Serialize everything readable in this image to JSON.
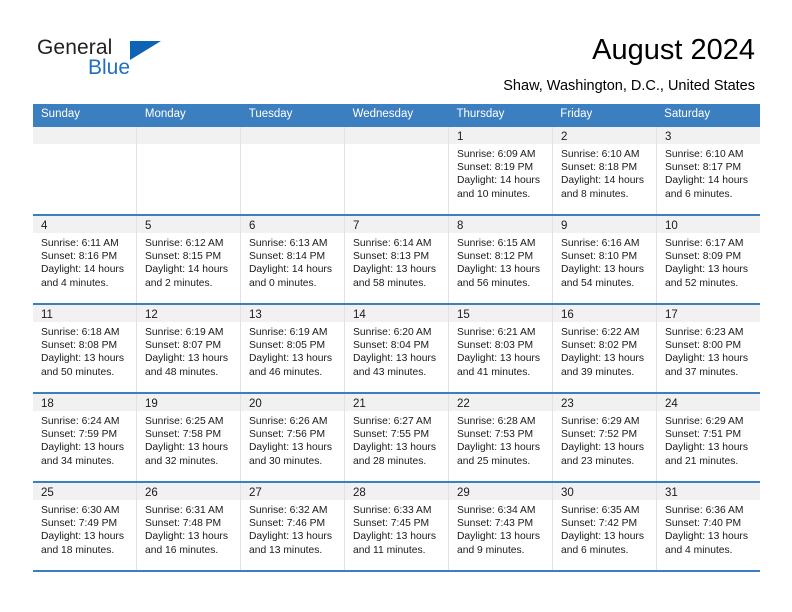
{
  "logo": {
    "word_top": "General",
    "word_bottom": "Blue",
    "accent_color": "#0f63b5"
  },
  "header": {
    "title": "August 2024",
    "subtitle": "Shaw, Washington, D.C., United States"
  },
  "calendar": {
    "header_color": "#3c7fc1",
    "weekdays": [
      "Sunday",
      "Monday",
      "Tuesday",
      "Wednesday",
      "Thursday",
      "Friday",
      "Saturday"
    ],
    "labels": {
      "sunrise": "Sunrise:",
      "sunset": "Sunset:",
      "daylight": "Daylight:"
    },
    "weeks": [
      [
        {
          "day": "",
          "sunrise": "",
          "sunset": "",
          "daylight_1": "",
          "daylight_2": ""
        },
        {
          "day": "",
          "sunrise": "",
          "sunset": "",
          "daylight_1": "",
          "daylight_2": ""
        },
        {
          "day": "",
          "sunrise": "",
          "sunset": "",
          "daylight_1": "",
          "daylight_2": ""
        },
        {
          "day": "",
          "sunrise": "",
          "sunset": "",
          "daylight_1": "",
          "daylight_2": ""
        },
        {
          "day": "1",
          "sunrise": "Sunrise: 6:09 AM",
          "sunset": "Sunset: 8:19 PM",
          "daylight_1": "Daylight: 14 hours",
          "daylight_2": "and 10 minutes."
        },
        {
          "day": "2",
          "sunrise": "Sunrise: 6:10 AM",
          "sunset": "Sunset: 8:18 PM",
          "daylight_1": "Daylight: 14 hours",
          "daylight_2": "and 8 minutes."
        },
        {
          "day": "3",
          "sunrise": "Sunrise: 6:10 AM",
          "sunset": "Sunset: 8:17 PM",
          "daylight_1": "Daylight: 14 hours",
          "daylight_2": "and 6 minutes."
        }
      ],
      [
        {
          "day": "4",
          "sunrise": "Sunrise: 6:11 AM",
          "sunset": "Sunset: 8:16 PM",
          "daylight_1": "Daylight: 14 hours",
          "daylight_2": "and 4 minutes."
        },
        {
          "day": "5",
          "sunrise": "Sunrise: 6:12 AM",
          "sunset": "Sunset: 8:15 PM",
          "daylight_1": "Daylight: 14 hours",
          "daylight_2": "and 2 minutes."
        },
        {
          "day": "6",
          "sunrise": "Sunrise: 6:13 AM",
          "sunset": "Sunset: 8:14 PM",
          "daylight_1": "Daylight: 14 hours",
          "daylight_2": "and 0 minutes."
        },
        {
          "day": "7",
          "sunrise": "Sunrise: 6:14 AM",
          "sunset": "Sunset: 8:13 PM",
          "daylight_1": "Daylight: 13 hours",
          "daylight_2": "and 58 minutes."
        },
        {
          "day": "8",
          "sunrise": "Sunrise: 6:15 AM",
          "sunset": "Sunset: 8:12 PM",
          "daylight_1": "Daylight: 13 hours",
          "daylight_2": "and 56 minutes."
        },
        {
          "day": "9",
          "sunrise": "Sunrise: 6:16 AM",
          "sunset": "Sunset: 8:10 PM",
          "daylight_1": "Daylight: 13 hours",
          "daylight_2": "and 54 minutes."
        },
        {
          "day": "10",
          "sunrise": "Sunrise: 6:17 AM",
          "sunset": "Sunset: 8:09 PM",
          "daylight_1": "Daylight: 13 hours",
          "daylight_2": "and 52 minutes."
        }
      ],
      [
        {
          "day": "11",
          "sunrise": "Sunrise: 6:18 AM",
          "sunset": "Sunset: 8:08 PM",
          "daylight_1": "Daylight: 13 hours",
          "daylight_2": "and 50 minutes."
        },
        {
          "day": "12",
          "sunrise": "Sunrise: 6:19 AM",
          "sunset": "Sunset: 8:07 PM",
          "daylight_1": "Daylight: 13 hours",
          "daylight_2": "and 48 minutes."
        },
        {
          "day": "13",
          "sunrise": "Sunrise: 6:19 AM",
          "sunset": "Sunset: 8:05 PM",
          "daylight_1": "Daylight: 13 hours",
          "daylight_2": "and 46 minutes."
        },
        {
          "day": "14",
          "sunrise": "Sunrise: 6:20 AM",
          "sunset": "Sunset: 8:04 PM",
          "daylight_1": "Daylight: 13 hours",
          "daylight_2": "and 43 minutes."
        },
        {
          "day": "15",
          "sunrise": "Sunrise: 6:21 AM",
          "sunset": "Sunset: 8:03 PM",
          "daylight_1": "Daylight: 13 hours",
          "daylight_2": "and 41 minutes."
        },
        {
          "day": "16",
          "sunrise": "Sunrise: 6:22 AM",
          "sunset": "Sunset: 8:02 PM",
          "daylight_1": "Daylight: 13 hours",
          "daylight_2": "and 39 minutes."
        },
        {
          "day": "17",
          "sunrise": "Sunrise: 6:23 AM",
          "sunset": "Sunset: 8:00 PM",
          "daylight_1": "Daylight: 13 hours",
          "daylight_2": "and 37 minutes."
        }
      ],
      [
        {
          "day": "18",
          "sunrise": "Sunrise: 6:24 AM",
          "sunset": "Sunset: 7:59 PM",
          "daylight_1": "Daylight: 13 hours",
          "daylight_2": "and 34 minutes."
        },
        {
          "day": "19",
          "sunrise": "Sunrise: 6:25 AM",
          "sunset": "Sunset: 7:58 PM",
          "daylight_1": "Daylight: 13 hours",
          "daylight_2": "and 32 minutes."
        },
        {
          "day": "20",
          "sunrise": "Sunrise: 6:26 AM",
          "sunset": "Sunset: 7:56 PM",
          "daylight_1": "Daylight: 13 hours",
          "daylight_2": "and 30 minutes."
        },
        {
          "day": "21",
          "sunrise": "Sunrise: 6:27 AM",
          "sunset": "Sunset: 7:55 PM",
          "daylight_1": "Daylight: 13 hours",
          "daylight_2": "and 28 minutes."
        },
        {
          "day": "22",
          "sunrise": "Sunrise: 6:28 AM",
          "sunset": "Sunset: 7:53 PM",
          "daylight_1": "Daylight: 13 hours",
          "daylight_2": "and 25 minutes."
        },
        {
          "day": "23",
          "sunrise": "Sunrise: 6:29 AM",
          "sunset": "Sunset: 7:52 PM",
          "daylight_1": "Daylight: 13 hours",
          "daylight_2": "and 23 minutes."
        },
        {
          "day": "24",
          "sunrise": "Sunrise: 6:29 AM",
          "sunset": "Sunset: 7:51 PM",
          "daylight_1": "Daylight: 13 hours",
          "daylight_2": "and 21 minutes."
        }
      ],
      [
        {
          "day": "25",
          "sunrise": "Sunrise: 6:30 AM",
          "sunset": "Sunset: 7:49 PM",
          "daylight_1": "Daylight: 13 hours",
          "daylight_2": "and 18 minutes."
        },
        {
          "day": "26",
          "sunrise": "Sunrise: 6:31 AM",
          "sunset": "Sunset: 7:48 PM",
          "daylight_1": "Daylight: 13 hours",
          "daylight_2": "and 16 minutes."
        },
        {
          "day": "27",
          "sunrise": "Sunrise: 6:32 AM",
          "sunset": "Sunset: 7:46 PM",
          "daylight_1": "Daylight: 13 hours",
          "daylight_2": "and 13 minutes."
        },
        {
          "day": "28",
          "sunrise": "Sunrise: 6:33 AM",
          "sunset": "Sunset: 7:45 PM",
          "daylight_1": "Daylight: 13 hours",
          "daylight_2": "and 11 minutes."
        },
        {
          "day": "29",
          "sunrise": "Sunrise: 6:34 AM",
          "sunset": "Sunset: 7:43 PM",
          "daylight_1": "Daylight: 13 hours",
          "daylight_2": "and 9 minutes."
        },
        {
          "day": "30",
          "sunrise": "Sunrise: 6:35 AM",
          "sunset": "Sunset: 7:42 PM",
          "daylight_1": "Daylight: 13 hours",
          "daylight_2": "and 6 minutes."
        },
        {
          "day": "31",
          "sunrise": "Sunrise: 6:36 AM",
          "sunset": "Sunset: 7:40 PM",
          "daylight_1": "Daylight: 13 hours",
          "daylight_2": "and 4 minutes."
        }
      ]
    ]
  }
}
